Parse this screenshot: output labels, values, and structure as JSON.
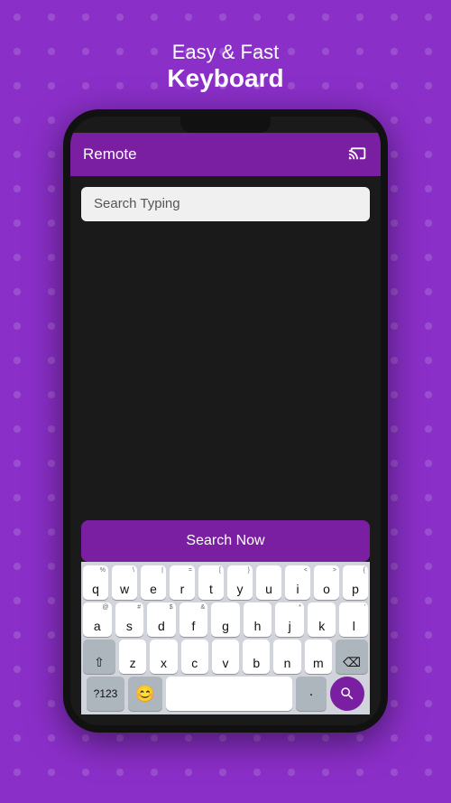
{
  "header": {
    "subtitle": "Easy & Fast",
    "title": "Keyboard"
  },
  "appBar": {
    "title": "Remote"
  },
  "search": {
    "placeholder": "Search Typing",
    "buttonLabel": "Search Now"
  },
  "keyboard": {
    "row1": [
      {
        "label": "q",
        "sub": "%"
      },
      {
        "label": "w",
        "sub": "\\"
      },
      {
        "label": "e",
        "sub": "|"
      },
      {
        "label": "r",
        "sub": "="
      },
      {
        "label": "t",
        "sub": "["
      },
      {
        "label": "y",
        "sub": "}"
      },
      {
        "label": "u",
        "sub": ""
      },
      {
        "label": "i",
        "sub": "<"
      },
      {
        "label": "o",
        "sub": ">"
      },
      {
        "label": "p",
        "sub": "{"
      }
    ],
    "row2": [
      {
        "label": "a",
        "sub": "@"
      },
      {
        "label": "s",
        "sub": "#"
      },
      {
        "label": "d",
        "sub": "$"
      },
      {
        "label": "f",
        "sub": "&"
      },
      {
        "label": "g",
        "sub": ""
      },
      {
        "label": "h",
        "sub": ""
      },
      {
        "label": "j",
        "sub": "*"
      },
      {
        "label": "k",
        "sub": ""
      },
      {
        "label": "l",
        "sub": "'"
      }
    ],
    "row3": [
      {
        "label": "z",
        "sub": ""
      },
      {
        "label": "x",
        "sub": ""
      },
      {
        "label": "c",
        "sub": ""
      },
      {
        "label": "v",
        "sub": ""
      },
      {
        "label": "b",
        "sub": ""
      },
      {
        "label": "n",
        "sub": ""
      },
      {
        "label": "m",
        "sub": ""
      }
    ],
    "bottomLeft": "?123",
    "dotLabel": ".",
    "spaceLabel": ""
  },
  "icons": {
    "cast": "⬛",
    "backspace": "⌫",
    "search": "🔍",
    "shift": "⇧",
    "emoji": "😊"
  }
}
